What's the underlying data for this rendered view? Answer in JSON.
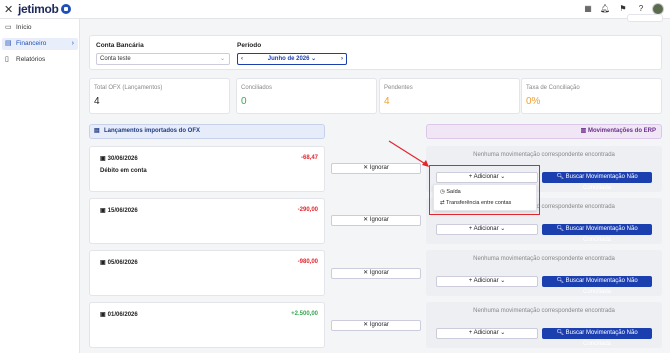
{
  "app": {
    "logo_text": "jetimob"
  },
  "sidebar": {
    "items": [
      {
        "label": "Início",
        "icon": "home-icon"
      },
      {
        "label": "Financeiro",
        "icon": "bank-icon"
      },
      {
        "label": "Relatórios",
        "icon": "report-icon"
      }
    ]
  },
  "filters": {
    "account_label": "Conta Bancária",
    "account_value": "Conta teste",
    "period_label": "Período",
    "period_value": "Junho de 2026"
  },
  "stats": [
    {
      "title": "Total OFX (Lançamentos)",
      "value": "4",
      "color": "#222222"
    },
    {
      "title": "Conciliados",
      "value": "0",
      "color": "#3aa650"
    },
    {
      "title": "Pendentes",
      "value": "4",
      "color": "#f0a030"
    },
    {
      "title": "Taxa de Conciliação",
      "value": "0%",
      "color": "#f0a030"
    }
  ],
  "sections": {
    "ofx_title": "Lançamentos importados do OFX",
    "erp_title": "Movimentações do ERP"
  },
  "rows": [
    {
      "date": "30/06/2026",
      "amount": "-68,47",
      "amount_color": "#e3262d",
      "desc": "Débito em conta"
    },
    {
      "date": "15/06/2026",
      "amount": "-290,00",
      "amount_color": "#e3262d",
      "desc": ""
    },
    {
      "date": "05/06/2026",
      "amount": "-980,00",
      "amount_color": "#e3262d",
      "desc": ""
    },
    {
      "date": "01/06/2026",
      "amount": "+2.500,00",
      "amount_color": "#3aa650",
      "desc": ""
    }
  ],
  "actions": {
    "ignore_label": "Ignorar",
    "no_match_msg": "Nenhuma movimentação correspondente encontrada",
    "add_label": "Adicionar",
    "search_label": "Buscar Movimentação Não Conciliada"
  },
  "dropdown": {
    "items": [
      {
        "label": "Saída",
        "icon": "clock-icon"
      },
      {
        "label": "Transferência entre contas",
        "icon": "transfer-icon"
      }
    ]
  },
  "colors": {
    "accent": "#1c3fb0",
    "annotation": "#e3262d"
  }
}
